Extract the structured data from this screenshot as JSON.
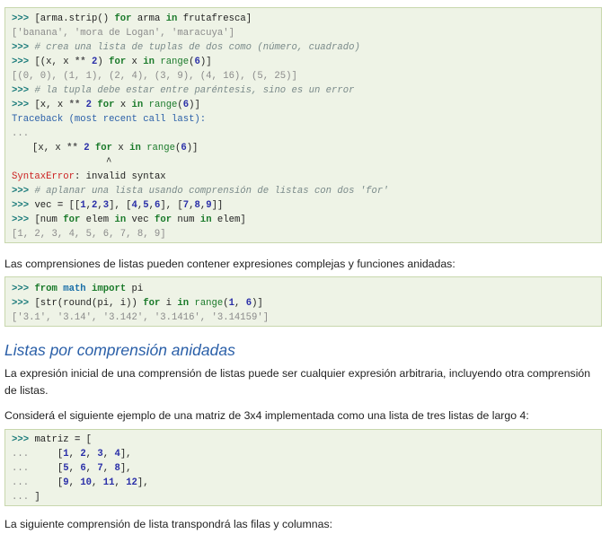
{
  "block1": {
    "l1": "[arma.strip() for arma in frutafresca]",
    "l1_pre": "[arma.strip() ",
    "l1_for": "for",
    "l1_mid": " arma ",
    "l1_in": "in",
    "l1_end": " frutafresca]",
    "o1": "['banana', 'mora de Logan', 'maracuya']",
    "c1": "# crea una lista de tuplas de dos como (número, cuadrado)",
    "l2_a": "[(x, x ",
    "l2_pow": "**",
    "l2_2": "2",
    "l2_b": ") ",
    "l2_for": "for",
    "l2_c": " x ",
    "l2_in": "in",
    "l2_d": " ",
    "l2_range": "range",
    "l2_e": "(",
    "l2_6": "6",
    "l2_f": ")]",
    "o2": "[(0, 0), (1, 1), (2, 4), (3, 9), (4, 16), (5, 25)]",
    "c2": "# la tupla debe estar entre paréntesis, sino es un error",
    "l3_a": "[x, x ",
    "l3_pow": "**",
    "l3_2": "2",
    "l3_b": " ",
    "l3_for": "for",
    "l3_c": " x ",
    "l3_in": "in",
    "l3_d": " ",
    "l3_range": "range",
    "l3_e": "(",
    "l3_6": "6",
    "l3_f": ")]",
    "tb": "Traceback (most recent call last):",
    "dots": "...",
    "caret": "^",
    "err_name": "SyntaxError",
    "err_msg": ": invalid syntax",
    "c3": "# aplanar una lista usando comprensión de listas con dos 'for'",
    "l4_a": "vec ",
    "l4_eq": "=",
    "l4_b": " [[",
    "l4_n1": "1",
    "l4_n2": "2",
    "l4_n3": "3",
    "l4_n4": "4",
    "l4_n5": "5",
    "l4_n6": "6",
    "l4_n7": "7",
    "l4_n8": "8",
    "l4_n9": "9",
    "l5_a": "[num ",
    "l5_for1": "for",
    "l5_b": " elem ",
    "l5_in1": "in",
    "l5_c": " vec ",
    "l5_for2": "for",
    "l5_d": " num ",
    "l5_in2": "in",
    "l5_e": " elem]",
    "o3": "[1, 2, 3, 4, 5, 6, 7, 8, 9]"
  },
  "para1": "Las comprensiones de listas pueden contener expresiones complejas y funciones anidadas:",
  "block2": {
    "from": "from",
    "math": "math",
    "import": "import",
    "pi": " pi",
    "l2_a": "[str(round(pi, i)) ",
    "l2_for": "for",
    "l2_b": " i ",
    "l2_in": "in",
    "l2_c": " ",
    "l2_range": "range",
    "l2_d": "(",
    "l2_1": "1",
    "l2_e": ", ",
    "l2_6": "6",
    "l2_f": ")]",
    "out": "['3.1', '3.14', '3.142', '3.1416', '3.14159']"
  },
  "heading": "Listas por comprensión anidadas",
  "para2": "La expresión inicial de una comprensión de listas puede ser cualquier expresión arbitraria, incluyendo otra comprensión de listas.",
  "para3": "Considerá el siguiente ejemplo de una matriz de 3x4 implementada como una lista de tres listas de largo 4:",
  "block3": {
    "l1": "matriz ",
    "eq": "=",
    "l1b": " [",
    "dots": "...",
    "r1": [
      "1",
      "2",
      "3",
      "4"
    ],
    "r2": [
      "5",
      "6",
      "7",
      "8"
    ],
    "r3": [
      "9",
      "10",
      "11",
      "12"
    ],
    "close": " ]"
  },
  "para4": "La siguiente comprensión de lista transpondrá las filas y columnas:",
  "prompt": ">>>",
  "colors": {
    "code_bg": "#eef3e6",
    "code_border": "#c8d7ad",
    "heading": "#2a5fa8",
    "keyword": "#1a7a2a",
    "number": "#2a2fa8",
    "error": "#cc2222"
  }
}
